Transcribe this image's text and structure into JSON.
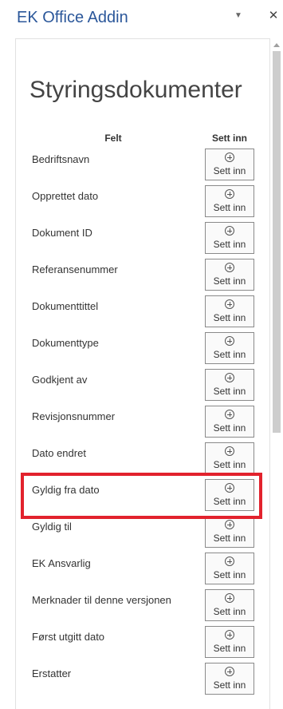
{
  "pane": {
    "title": "EK Office Addin",
    "menu_icon": "chevron-down-icon",
    "close_icon": "close-icon",
    "menu_glyph": "▼",
    "close_glyph": "✕"
  },
  "document": {
    "heading": "Styringsdokumenter",
    "column_field": "Felt",
    "column_insert": "Sett inn"
  },
  "fields": [
    {
      "label": "Bedriftsnavn",
      "button": "Sett inn"
    },
    {
      "label": "Opprettet dato",
      "button": "Sett inn"
    },
    {
      "label": "Dokument ID",
      "button": "Sett inn"
    },
    {
      "label": "Referansenummer",
      "button": "Sett inn"
    },
    {
      "label": "Dokumenttittel",
      "button": "Sett inn"
    },
    {
      "label": "Dokumenttype",
      "button": "Sett inn"
    },
    {
      "label": "Godkjent av",
      "button": "Sett inn"
    },
    {
      "label": "Revisjonsnummer",
      "button": "Sett inn"
    },
    {
      "label": "Dato endret",
      "button": "Sett inn"
    },
    {
      "label": "Gyldig fra dato",
      "button": "Sett inn"
    },
    {
      "label": "Gyldig til",
      "button": "Sett inn"
    },
    {
      "label": "EK Ansvarlig",
      "button": "Sett inn"
    },
    {
      "label": "Merknader til denne versjonen",
      "button": "Sett inn"
    },
    {
      "label": "Først utgitt dato",
      "button": "Sett inn"
    },
    {
      "label": "Erstatter",
      "button": "Sett inn"
    }
  ],
  "highlighted_field": "Gyldig fra dato",
  "colors": {
    "title": "#2b579a",
    "highlight": "#e2222d",
    "button_border": "#8a8a8a",
    "scroll_thumb": "#cdcdcd"
  }
}
